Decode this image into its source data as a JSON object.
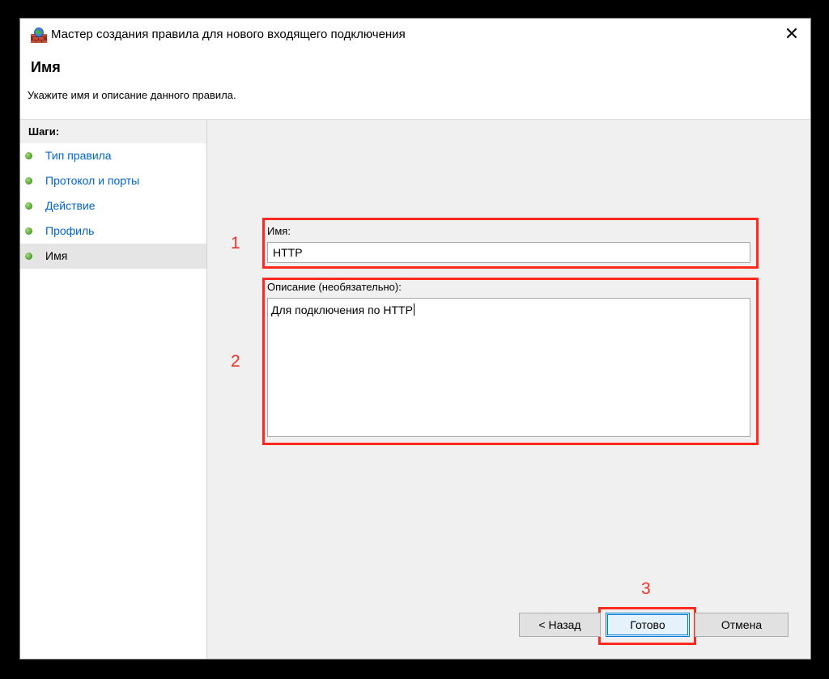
{
  "window": {
    "title": "Мастер создания правила для нового входящего подключения",
    "close_glyph": "✕"
  },
  "header": {
    "title": "Имя",
    "description": "Укажите имя и описание данного правила."
  },
  "sidebar": {
    "heading": "Шаги:",
    "steps": [
      {
        "label": "Тип правила"
      },
      {
        "label": "Протокол и порты"
      },
      {
        "label": "Действие"
      },
      {
        "label": "Профиль"
      },
      {
        "label": "Имя"
      }
    ]
  },
  "form": {
    "name_label": "Имя:",
    "name_value": "HTTP",
    "description_label": "Описание (необязательно):",
    "description_value": "Для подключения по HTTP"
  },
  "annotations": {
    "num1": "1",
    "num2": "2",
    "num3": "3",
    "color": "#ff2a1f"
  },
  "buttons": {
    "back": "< Назад",
    "finish": "Готово",
    "cancel": "Отмена"
  },
  "colors": {
    "link": "#0066cc",
    "accent": "#0078d7"
  },
  "icons": {
    "title": "firewall-icon",
    "step_status": "green-dot-icon"
  }
}
